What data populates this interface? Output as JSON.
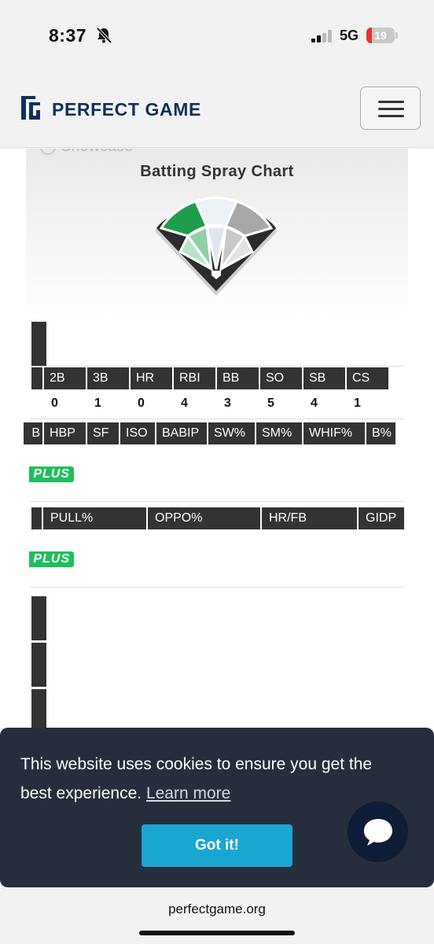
{
  "status": {
    "time": "8:37",
    "network": "5G",
    "battery_level": "19",
    "battery_fraction": 0.19
  },
  "header": {
    "brand": "PERFECT GAME"
  },
  "spray_chart": {
    "ghost_label": "Showcase",
    "title": "Batting Spray Chart"
  },
  "stats1": {
    "headers": [
      "",
      "2B",
      "3B",
      "HR",
      "RBI",
      "BB",
      "SO",
      "SB",
      "CS"
    ],
    "values": [
      "0",
      "1",
      "0",
      "4",
      "3",
      "5",
      "4",
      "1"
    ]
  },
  "stats2": {
    "headers": [
      "B",
      "HBP",
      "SF",
      "ISO",
      "BABIP",
      "SW%",
      "SM%",
      "WHIF%",
      "B%"
    ]
  },
  "stats3": {
    "headers": [
      "",
      "PULL%",
      "OPPO%",
      "HR/FB",
      "GIDP"
    ]
  },
  "plus_badge": "PLUS",
  "cookie": {
    "message": "This website uses cookies to ensure you get the best experience.",
    "learn_more": "Learn more",
    "accept": "Got it!"
  },
  "footer": {
    "url": "perfectgame.org"
  },
  "colors": {
    "brand": "#12305a",
    "accept_button": "#19a6d1",
    "plus": "#1fbf5c",
    "spray_green": "#1f9d4a"
  }
}
